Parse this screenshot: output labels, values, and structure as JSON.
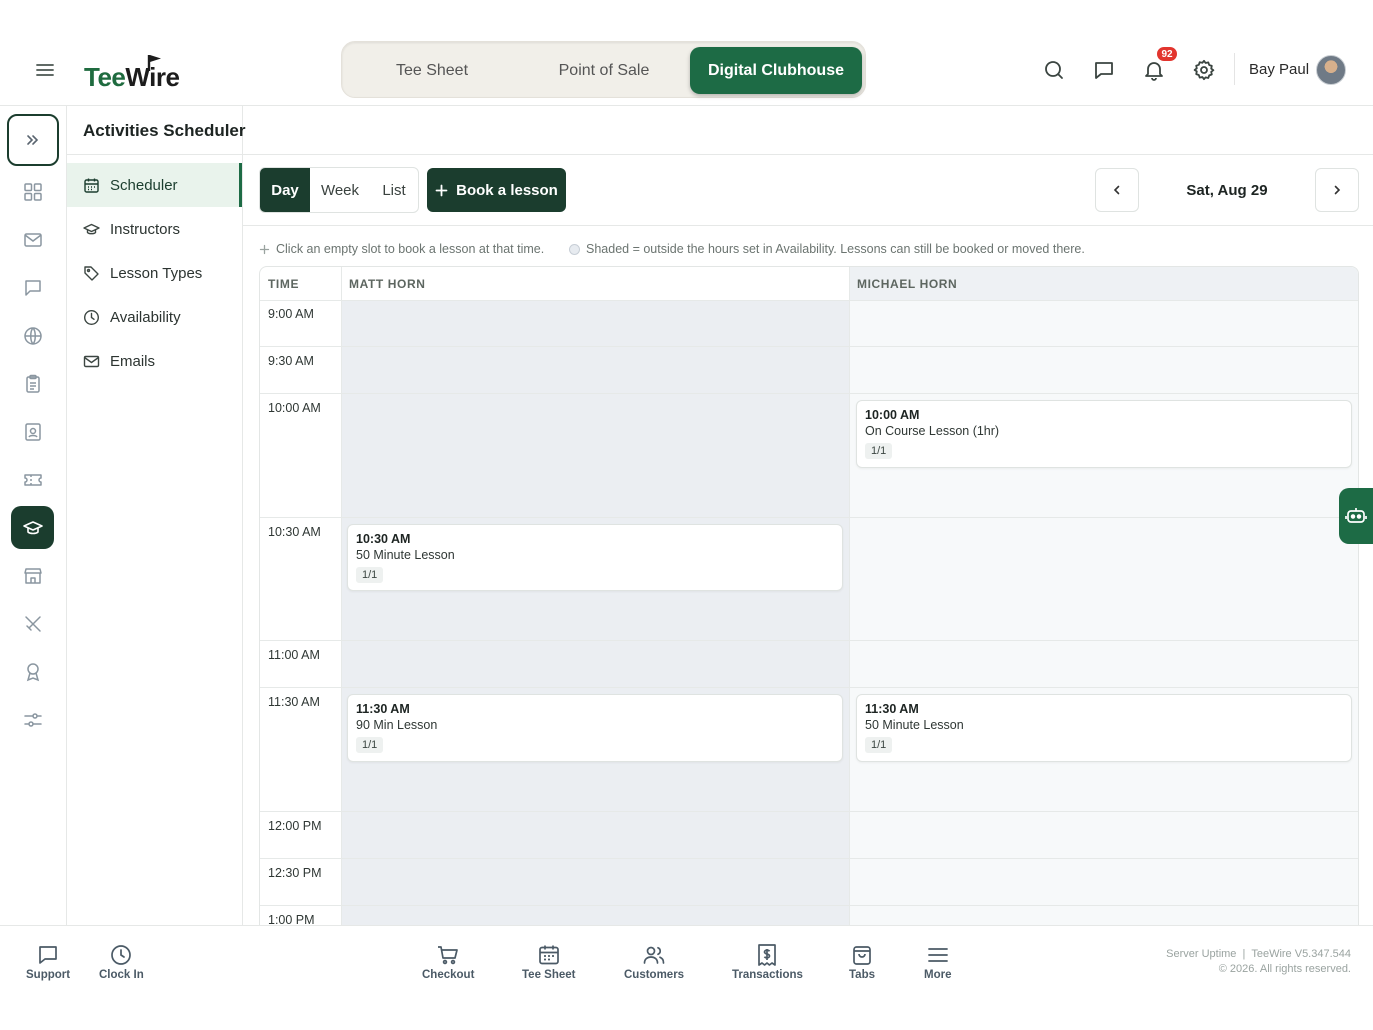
{
  "header": {
    "logo_part1": "Tee",
    "logo_part2": "Wire",
    "app_tabs": [
      "Tee Sheet",
      "Point of Sale",
      "Digital Clubhouse"
    ],
    "active_app_tab": "Digital Clubhouse",
    "notification_count": "92",
    "user_name": "Bay Paul"
  },
  "page": {
    "title": "Activities Scheduler"
  },
  "sidebar": {
    "items": [
      {
        "label": "Scheduler",
        "icon": "calendar-icon",
        "active": true
      },
      {
        "label": "Instructors",
        "icon": "graduation-cap-icon",
        "active": false
      },
      {
        "label": "Lesson Types",
        "icon": "tag-icon",
        "active": false
      },
      {
        "label": "Availability",
        "icon": "clock-icon",
        "active": false
      },
      {
        "label": "Emails",
        "icon": "mail-icon",
        "active": false
      }
    ]
  },
  "toolbar": {
    "views": [
      "Day",
      "Week",
      "List"
    ],
    "active_view": "Day",
    "book_label": "Book a lesson",
    "date": "Sat, Aug 29"
  },
  "hints": {
    "click_hint": "Click an empty slot to book a lesson at that time.",
    "shaded_hint": "Shaded = outside the hours set in Availability. Lessons can still be booked or moved there."
  },
  "grid": {
    "time_header": "TIME",
    "instructors": [
      "MATT HORN",
      "MICHAEL HORN"
    ],
    "times": [
      "9:00 AM",
      "9:30 AM",
      "10:00 AM",
      "10:30 AM",
      "11:00 AM",
      "11:30 AM",
      "12:00 PM",
      "12:30 PM",
      "1:00 PM"
    ],
    "events": [
      {
        "instructor": "MICHAEL HORN",
        "time": "10:00 AM",
        "name": "On Course Lesson (1hr)",
        "capacity": "1/1"
      },
      {
        "instructor": "MATT HORN",
        "time": "10:30 AM",
        "name": "50 Minute Lesson",
        "capacity": "1/1"
      },
      {
        "instructor": "MATT HORN",
        "time": "11:30 AM",
        "name": "90 Min Lesson",
        "capacity": "1/1"
      },
      {
        "instructor": "MICHAEL HORN",
        "time": "11:30 AM",
        "name": "50 Minute Lesson",
        "capacity": "1/1"
      }
    ]
  },
  "footer": {
    "left": [
      {
        "label": "Support",
        "icon": "message-square-icon"
      },
      {
        "label": "Clock In",
        "icon": "clock-icon"
      }
    ],
    "nav": [
      {
        "label": "Checkout",
        "icon": "cart-icon"
      },
      {
        "label": "Tee Sheet",
        "icon": "calendar-icon"
      },
      {
        "label": "Customers",
        "icon": "users-icon"
      },
      {
        "label": "Transactions",
        "icon": "receipt-icon"
      },
      {
        "label": "Tabs",
        "icon": "bag-icon"
      },
      {
        "label": "More",
        "icon": "menu-icon"
      }
    ],
    "server_uptime": "Server Uptime",
    "version": "TeeWire V5.347.544",
    "copyright": "© 2026. All rights reserved."
  },
  "colors": {
    "brand_green": "#1d6b45",
    "dark_green": "#1b3d2e",
    "badge_red": "#e2352e",
    "shaded_slot": "#ebeef2"
  }
}
